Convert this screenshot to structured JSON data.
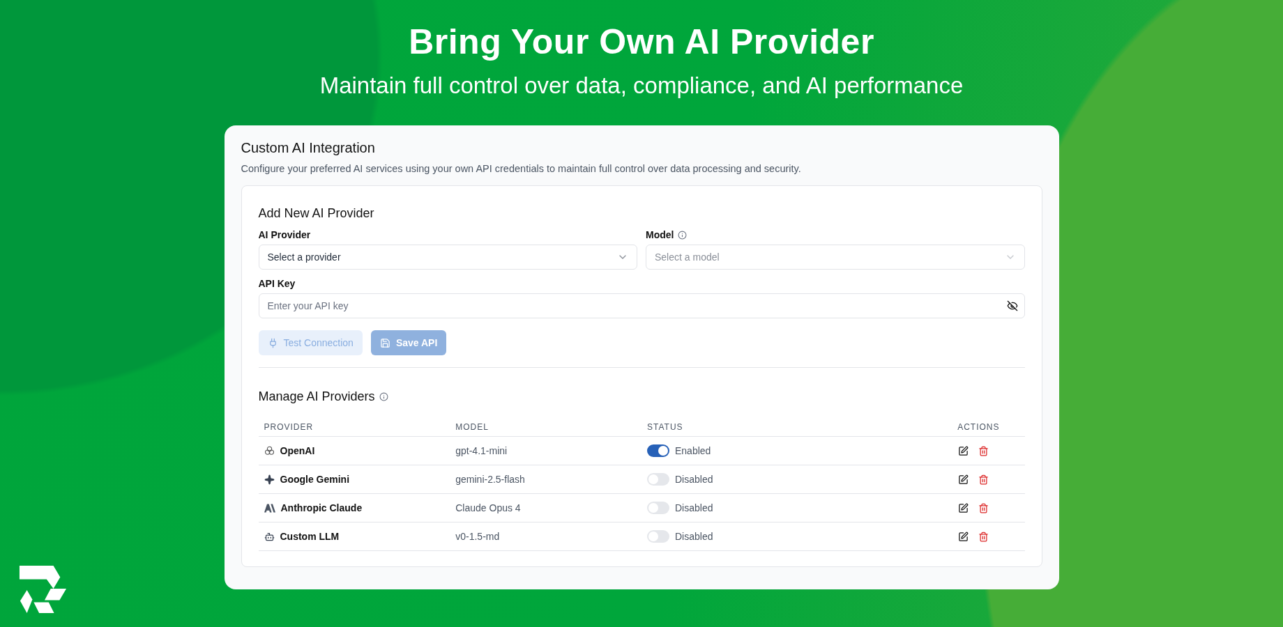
{
  "hero": {
    "title": "Bring Your Own AI Provider",
    "subtitle": "Maintain full control over data, compliance, and AI performance"
  },
  "card": {
    "title": "Custom AI Integration",
    "description": "Configure your preferred AI services using your own API credentials to maintain full control over data processing and security."
  },
  "add_form": {
    "heading": "Add New AI Provider",
    "provider_field": {
      "label": "AI Provider",
      "placeholder": "Select a provider",
      "disabled": false
    },
    "model_field": {
      "label": "Model",
      "placeholder": "Select a model",
      "disabled": true
    },
    "api_key_field": {
      "label": "API Key",
      "placeholder": "Enter your API key"
    },
    "buttons": [
      {
        "label": "Test Connection",
        "kind": "secondary",
        "disabled": true
      },
      {
        "label": "Save API",
        "kind": "primary",
        "disabled": true
      }
    ]
  },
  "providers_table": {
    "heading": "Manage AI Providers",
    "columns": [
      "PROVIDER",
      "MODEL",
      "STATUS",
      "ACTIONS"
    ],
    "rows": [
      {
        "provider": "OpenAI",
        "model": "gpt-4.1-mini",
        "enabled": true,
        "status": "Enabled"
      },
      {
        "provider": "Google Gemini",
        "model": "gemini-2.5-flash",
        "enabled": false,
        "status": "Disabled"
      },
      {
        "provider": "Anthropic Claude",
        "model": "Claude Opus 4",
        "enabled": false,
        "status": "Disabled"
      },
      {
        "provider": "Custom LLM",
        "model": "v0-1.5-md",
        "enabled": false,
        "status": "Disabled"
      }
    ]
  }
}
